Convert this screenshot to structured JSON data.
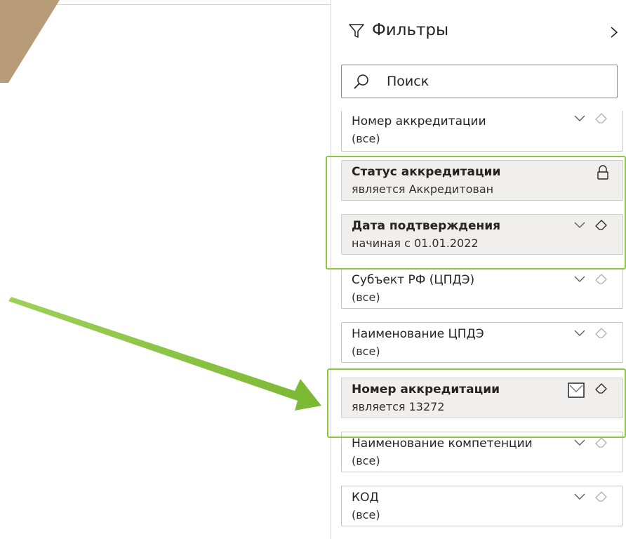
{
  "pane": {
    "title": "Фильтры",
    "search": {
      "value": "Поиск"
    }
  },
  "filters": [
    {
      "title": "Номер аккредитации",
      "value": "(все)",
      "applied": false
    },
    {
      "title": "Статус аккредитации",
      "value": "является Аккредитован",
      "applied": true,
      "locked": true
    },
    {
      "title": "Дата подтверждения",
      "value": "начиная с 01.01.2022",
      "applied": true
    },
    {
      "title": "Субъект РФ (ЦПДЭ)",
      "value": "(все)",
      "applied": false
    },
    {
      "title": "Наименование ЦПДЭ",
      "value": "(все)",
      "applied": false
    },
    {
      "title": "Номер аккредитации",
      "value": "является 13272",
      "applied": true
    },
    {
      "title": "Наименование компетенции",
      "value": "(все)",
      "applied": false
    },
    {
      "title": "КОД",
      "value": "(все)",
      "applied": false
    }
  ],
  "icons": {
    "filter": "funnel-icon",
    "collapse": "chevron-right-icon",
    "search": "magnifier-icon",
    "expand": "chevron-down-icon",
    "clear": "eraser-icon",
    "lock": "lock-icon",
    "checkbox": "checkbox-icon"
  },
  "colors": {
    "highlight": "#8fc641",
    "arrow": "#8cc63f",
    "decoration": "#b89b79",
    "applied_card": "#f0efee"
  }
}
